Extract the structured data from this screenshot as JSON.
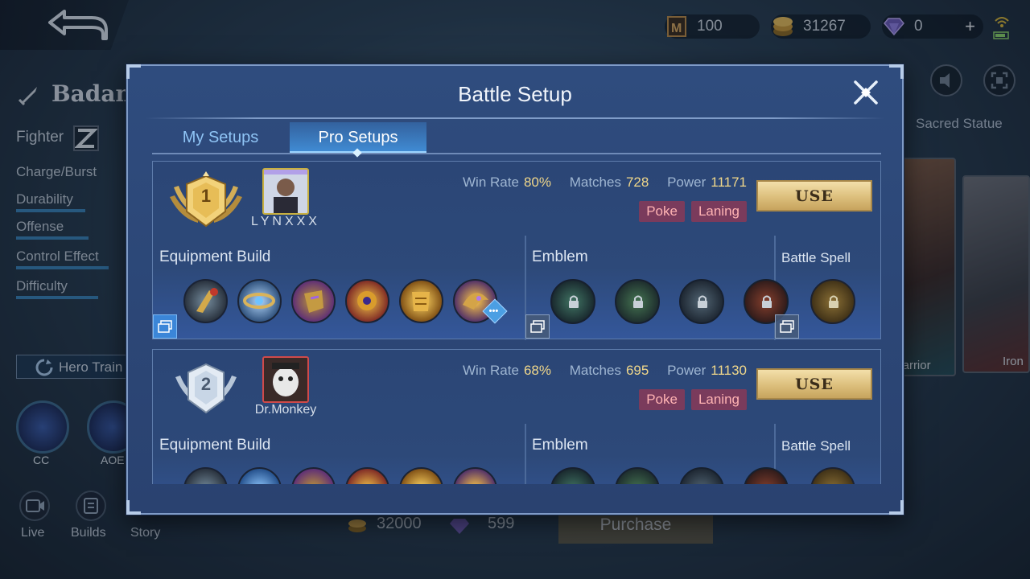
{
  "resources": {
    "tickets": "100",
    "gold": "31267",
    "diamonds": "0",
    "plus": "+"
  },
  "hero": {
    "name": "Badang",
    "role": "Fighter",
    "stats": [
      "Charge/Burst",
      "Durability",
      "Offense",
      "Control Effect",
      "Difficulty"
    ],
    "stat_levels": [
      0,
      0.52,
      0.55,
      0.7,
      0.62
    ],
    "train_label": "Hero Train",
    "circles": [
      "CC",
      "AOE"
    ],
    "nav": [
      "Live",
      "Builds",
      "Story"
    ]
  },
  "right_panel": {
    "sacred": "Sacred Statue",
    "skin1": "Warrior",
    "skin2": "Iron"
  },
  "bottom": {
    "price_gold": "32000",
    "price_diamond": "599",
    "purchase": "Purchase"
  },
  "modal": {
    "title": "Battle Setup",
    "tabs": [
      "My Setups",
      "Pro Setups"
    ],
    "active_tab": "Pro Setups",
    "section_labels": {
      "equipment": "Equipment Build",
      "emblem": "Emblem",
      "spell": "Battle Spell"
    },
    "labels": {
      "win_rate": "Win Rate",
      "matches": "Matches",
      "power": "Power",
      "use": "USE"
    },
    "setups": [
      {
        "rank": "1",
        "player": "LYNXXX",
        "win_rate": "80%",
        "matches": "728",
        "power": "11171",
        "tags": [
          "Poke",
          "Laning"
        ]
      },
      {
        "rank": "2",
        "player": "Dr.Monkey",
        "win_rate": "68%",
        "matches": "695",
        "power": "11130",
        "tags": [
          "Poke",
          "Laning"
        ]
      }
    ],
    "colors": {
      "accent_gold": "#f0d78a",
      "tag_bg": "#7a3b5c",
      "active_tab": "#3c8ce0"
    }
  }
}
